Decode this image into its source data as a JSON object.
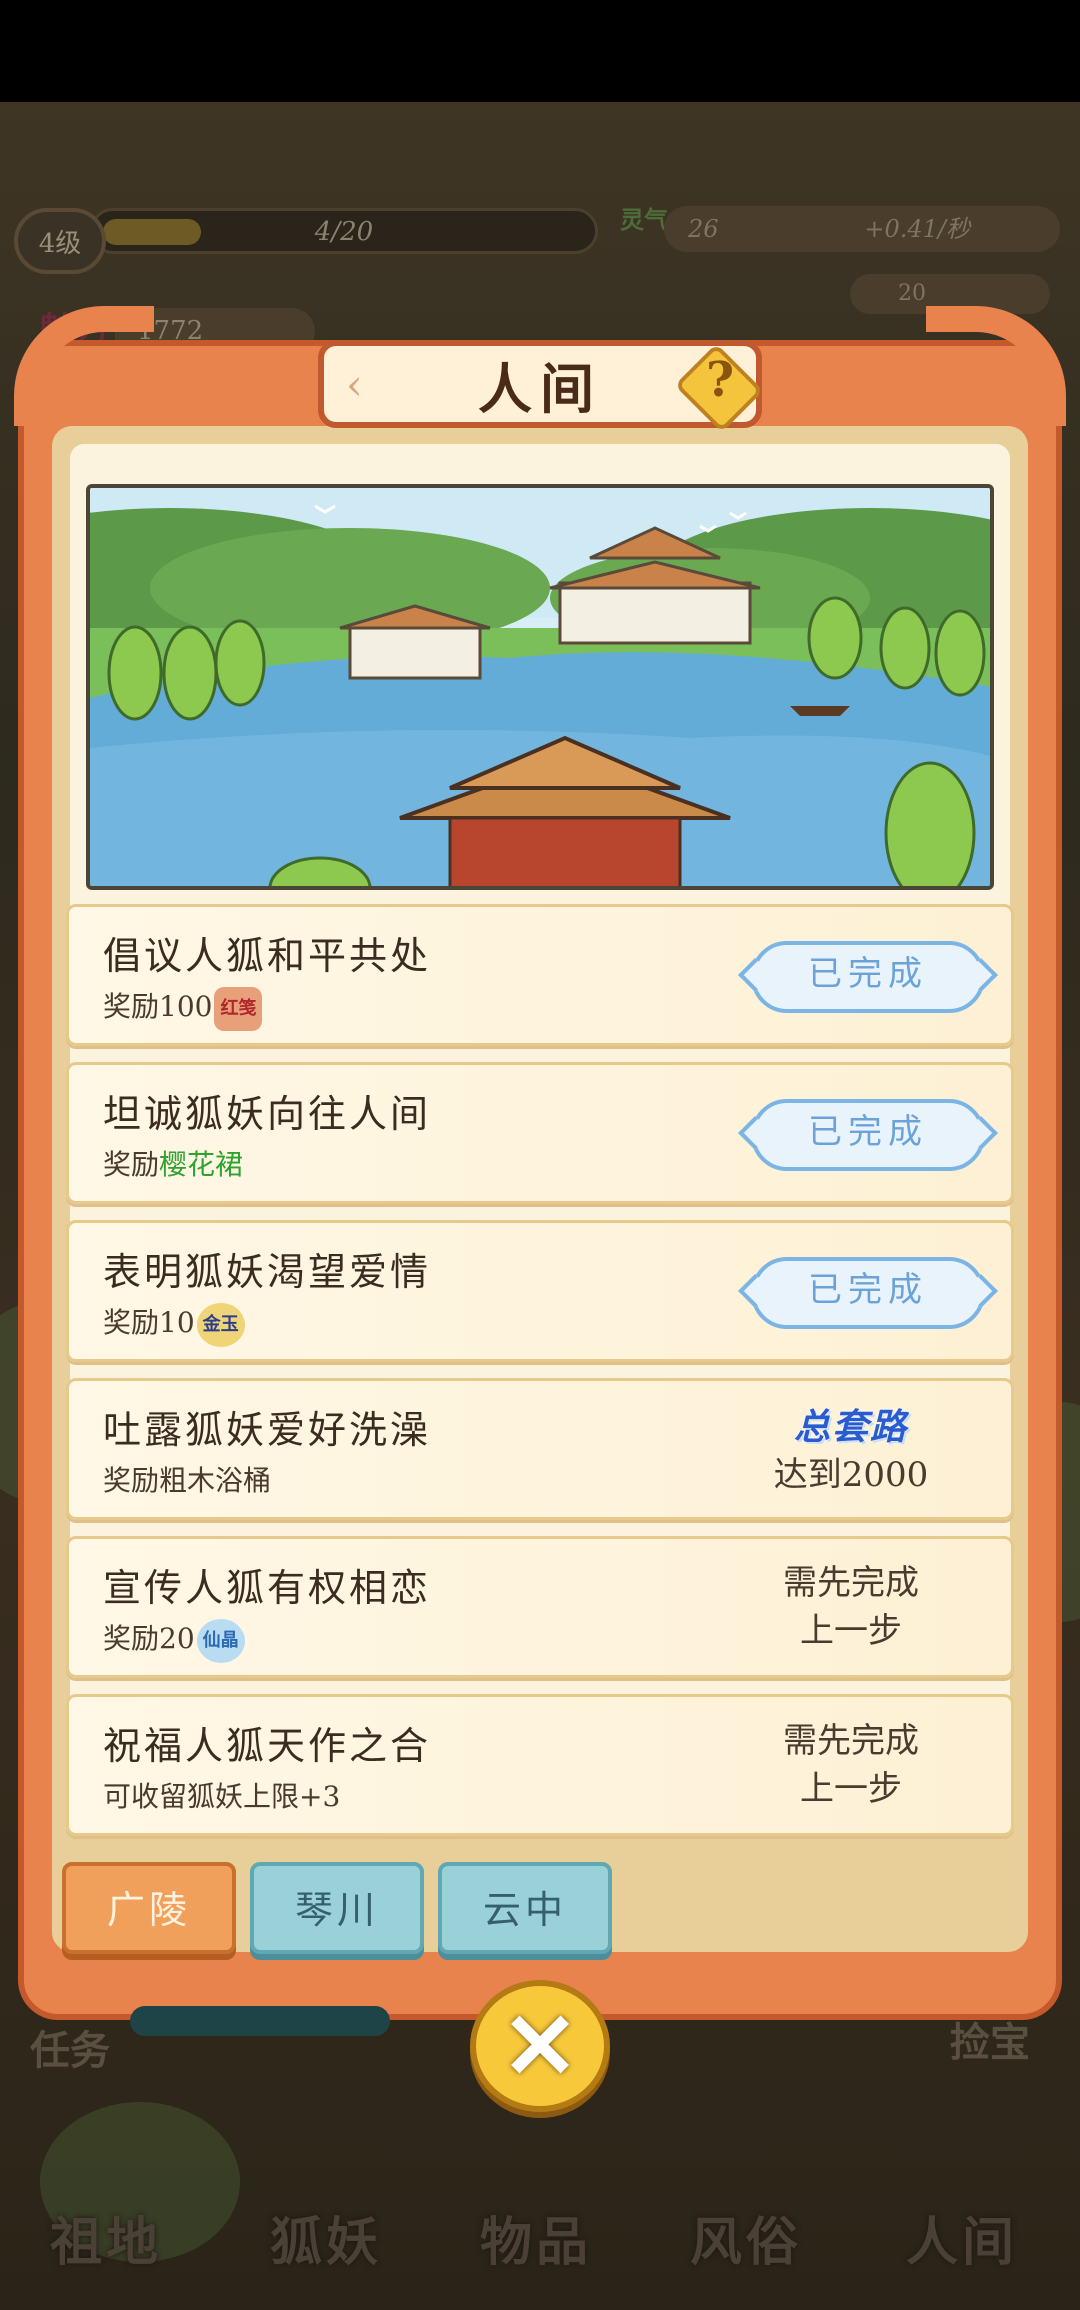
{
  "hud": {
    "level": "4级",
    "exp": "4/20",
    "exp_progress": 0.2,
    "charm_label": "魅力",
    "charm_value": "1772",
    "spirit_label": "灵气",
    "spirit_value": "26",
    "spirit_rate": "+0.41/秒",
    "crystal_value": "20"
  },
  "dialog": {
    "title": "人间",
    "help_icon": "question-mark-icon",
    "close_icon": "close-x-icon"
  },
  "tasks": [
    {
      "name": "倡议人狐和平共处",
      "reward_prefix": "奖励100",
      "reward_icon": "红笺",
      "reward_icon_name": "red-paper-icon",
      "status": "已完成"
    },
    {
      "name": "坦诚狐妖向往人间",
      "reward_prefix": "奖励",
      "reward_item": "樱花裙",
      "status": "已完成"
    },
    {
      "name": "表明狐妖渴望爱情",
      "reward_prefix": "奖励10",
      "reward_icon": "金玉",
      "reward_icon_name": "gold-jade-icon",
      "status": "已完成"
    },
    {
      "name": "吐露狐妖爱好洗澡",
      "reward_prefix": "奖励粗木浴桶",
      "status_title": "总套路",
      "status_line": "达到2000"
    },
    {
      "name": "宣传人狐有权相恋",
      "reward_prefix": "奖励20",
      "reward_icon": "仙晶",
      "reward_icon_name": "crystal-icon",
      "status_line1": "需先完成",
      "status_line2": "上一步"
    },
    {
      "name": "祝福人狐天作之合",
      "reward_prefix": "可收留狐妖上限+3",
      "status_line1": "需先完成",
      "status_line2": "上一步"
    }
  ],
  "tabs": [
    {
      "label": "广陵",
      "active": true
    },
    {
      "label": "琴川",
      "active": false
    },
    {
      "label": "云中",
      "active": false
    }
  ],
  "bottom": {
    "task_label": "任务",
    "treasure_label": "捡宝",
    "nav": [
      "祖地",
      "狐妖",
      "物品",
      "风俗",
      "人间"
    ]
  },
  "colors": {
    "panel_orange": "#e9834d",
    "done_blue": "#6ba3d8",
    "reward_green": "#2fa22f",
    "total_road_blue": "#2a5cd0"
  }
}
